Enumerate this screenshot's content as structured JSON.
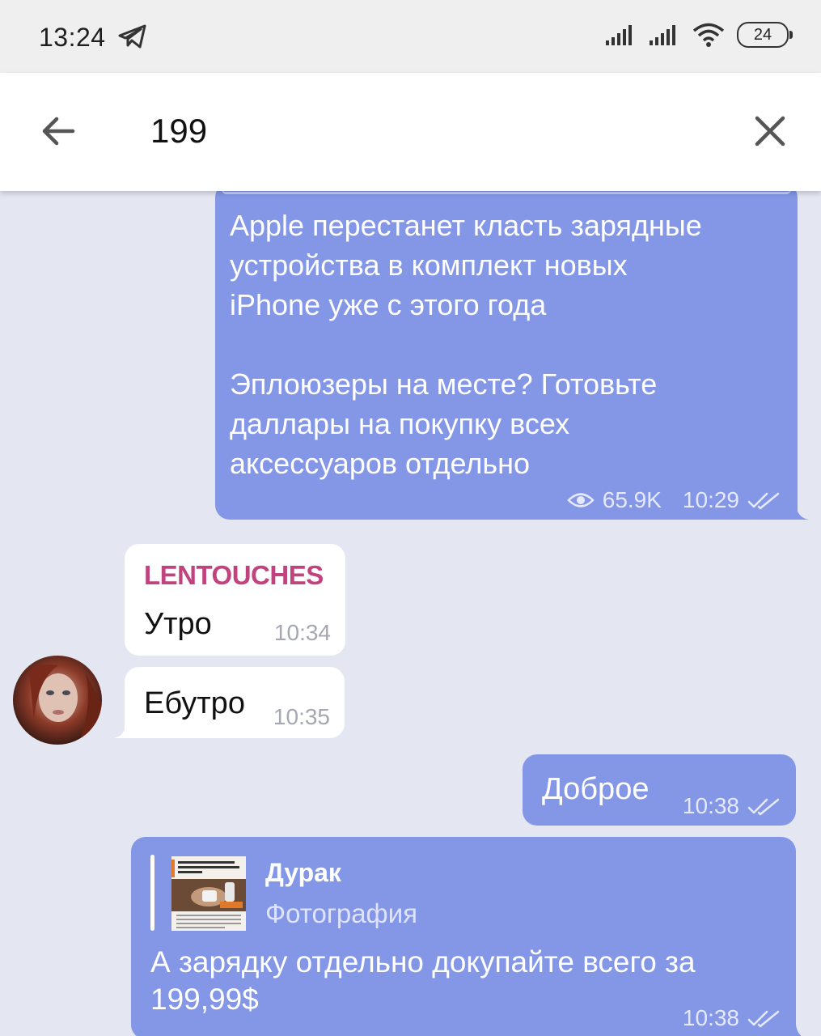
{
  "status_bar": {
    "time": "13:24",
    "battery": "24",
    "icons": [
      "telegram-icon",
      "signal-icon",
      "signal-icon",
      "wifi-icon",
      "battery-icon"
    ]
  },
  "header": {
    "back_icon": "arrow-left-icon",
    "search_value": "199",
    "close_icon": "close-icon"
  },
  "colors": {
    "outgoing_bubble": "#8497e6",
    "incoming_bubble": "#ffffff",
    "chat_background": "#e4e6f2",
    "sender_name": "#c2427e"
  },
  "messages": [
    {
      "text": "Apple перестанет класть зарядные\nустройства в комплект новых\niPhone уже с этого года\n\nЭплоюзеры на месте? Готовьте\nдаллары на покупку всех\nаксессуаров отдельно",
      "views": "65.9K",
      "time": "10:29"
    },
    {
      "sender": "LENTOUCHES",
      "text": "Утро",
      "time": "10:34"
    },
    {
      "text": "Ебутро",
      "time": "10:35"
    },
    {
      "text": "Доброе",
      "time": "10:38"
    },
    {
      "reply_name": "Дурак",
      "reply_type": "Фотография",
      "text": "А зарядку отдельно докупайте всего за\n199,99$",
      "time": "10:38"
    }
  ]
}
